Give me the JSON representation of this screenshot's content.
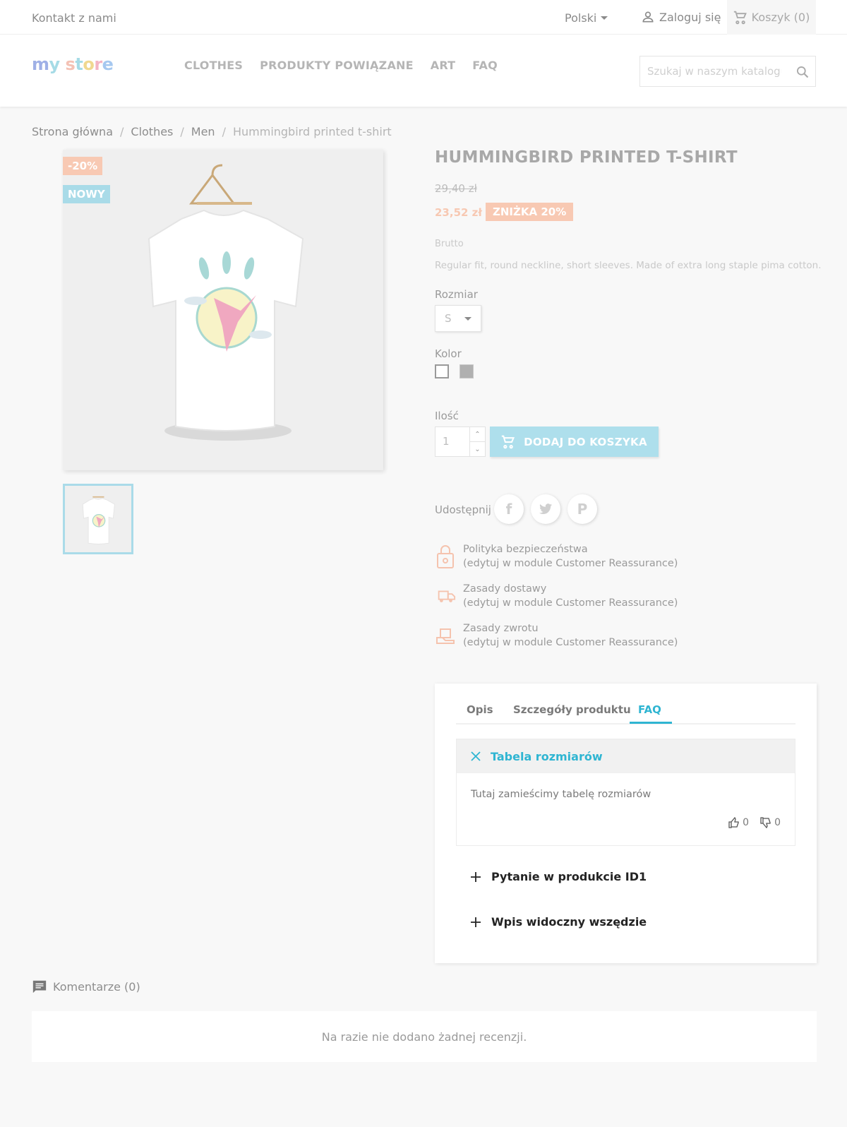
{
  "topbar": {
    "contact": "Kontakt z nami",
    "language": "Polski",
    "login": "Zaloguj się",
    "cart": "Koszyk (0)"
  },
  "header": {
    "logo": "my store",
    "nav": [
      "CLOTHES",
      "PRODUKTY POWIĄZANE",
      "ART",
      "FAQ"
    ],
    "search_placeholder": "Szukaj w naszym katalogu"
  },
  "breadcrumb": [
    "Strona główna",
    "Clothes",
    "Men",
    "Hummingbird printed t-shirt"
  ],
  "product": {
    "flags": {
      "discount": "-20%",
      "new": "NOWY"
    },
    "title": "HUMMINGBIRD PRINTED T-SHIRT",
    "old_price": "29,40 zł",
    "price": "23,52 zł",
    "discount_badge": "ZNIŻKA 20%",
    "tax_label": "Brutto",
    "short_description": "Regular fit, round neckline, short sleeves. Made of extra long staple pima cotton.",
    "size_label": "Rozmiar",
    "size_value": "S",
    "color_label": "Kolor",
    "colors": [
      "#ffffff",
      "#b0b0b0"
    ],
    "qty_label": "Ilość",
    "qty_value": "1",
    "add_to_cart": "DODAJ DO KOSZYKA",
    "share_label": "Udostępnij"
  },
  "reassurance": [
    {
      "title": "Polityka bezpieczeństwa",
      "sub": "(edytuj w module Customer Reassurance)",
      "icon": "lock-icon"
    },
    {
      "title": "Zasady dostawy",
      "sub": "(edytuj w module Customer Reassurance)",
      "icon": "truck-icon"
    },
    {
      "title": "Zasady zwrotu",
      "sub": "(edytuj w module Customer Reassurance)",
      "icon": "return-box-icon"
    }
  ],
  "tabs": {
    "items": [
      "Opis",
      "Szczegóły produktu",
      "FAQ"
    ],
    "active": "FAQ"
  },
  "faq": {
    "open": {
      "question": "Tabela rozmiarów",
      "answer": "Tutaj zamieścimy tabelę rozmiarów",
      "likes": "0",
      "dislikes": "0"
    },
    "closed": [
      "Pytanie w produkcie ID1",
      "Wpis widoczny wszędzie"
    ]
  },
  "comments": {
    "title": "Komentarze (0)",
    "empty": "Na razie nie dodano żadnej recenzji."
  },
  "colors": {
    "accent": "#2fb5d2",
    "discount": "#f8c9b3",
    "new_flag": "#a9dbe8"
  }
}
